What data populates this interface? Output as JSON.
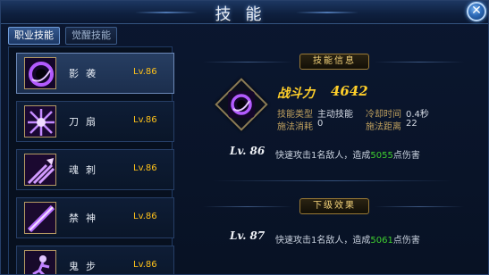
{
  "window": {
    "title": "技能",
    "close_label": "✕"
  },
  "tabs": [
    {
      "label": "职业技能",
      "active": true
    },
    {
      "label": "觉醒技能",
      "active": false
    }
  ],
  "skills": [
    {
      "name": "影袭",
      "level": "Lv.86",
      "icon": "shadow-strike-icon",
      "selected": true
    },
    {
      "name": "刀扇",
      "level": "Lv.86",
      "icon": "blade-fan-icon",
      "selected": false
    },
    {
      "name": "魂刺",
      "level": "Lv.86",
      "icon": "soul-stab-icon",
      "selected": false
    },
    {
      "name": "禁神",
      "level": "Lv.86",
      "icon": "forbidden-god-icon",
      "selected": false
    },
    {
      "name": "鬼步",
      "level": "Lv.86",
      "icon": "ghost-step-icon",
      "selected": false
    }
  ],
  "detail": {
    "section_info": "技能信息",
    "power_label": "战斗力",
    "power_value": "4642",
    "type_label": "技能类型",
    "type_value": "主动技能",
    "cooldown_label": "冷却时间",
    "cooldown_value": "0.4秒",
    "cost_label": "施法消耗",
    "cost_value": "0",
    "range_label": "施法距离",
    "range_value": "22",
    "current_level": "Lv. 86",
    "current_desc_pre": "快速攻击1名敌人，造成",
    "current_damage": "5055",
    "current_desc_post": "点伤害",
    "section_next": "下级效果",
    "next_level": "Lv. 87",
    "next_desc_pre": "快速攻击1名敌人，造成",
    "next_damage": "5061",
    "next_desc_post": "点伤害"
  },
  "colors": {
    "gold": "#ffcf2a",
    "damage_green": "#3fcf2f",
    "level_yellow": "#ffc21a"
  }
}
